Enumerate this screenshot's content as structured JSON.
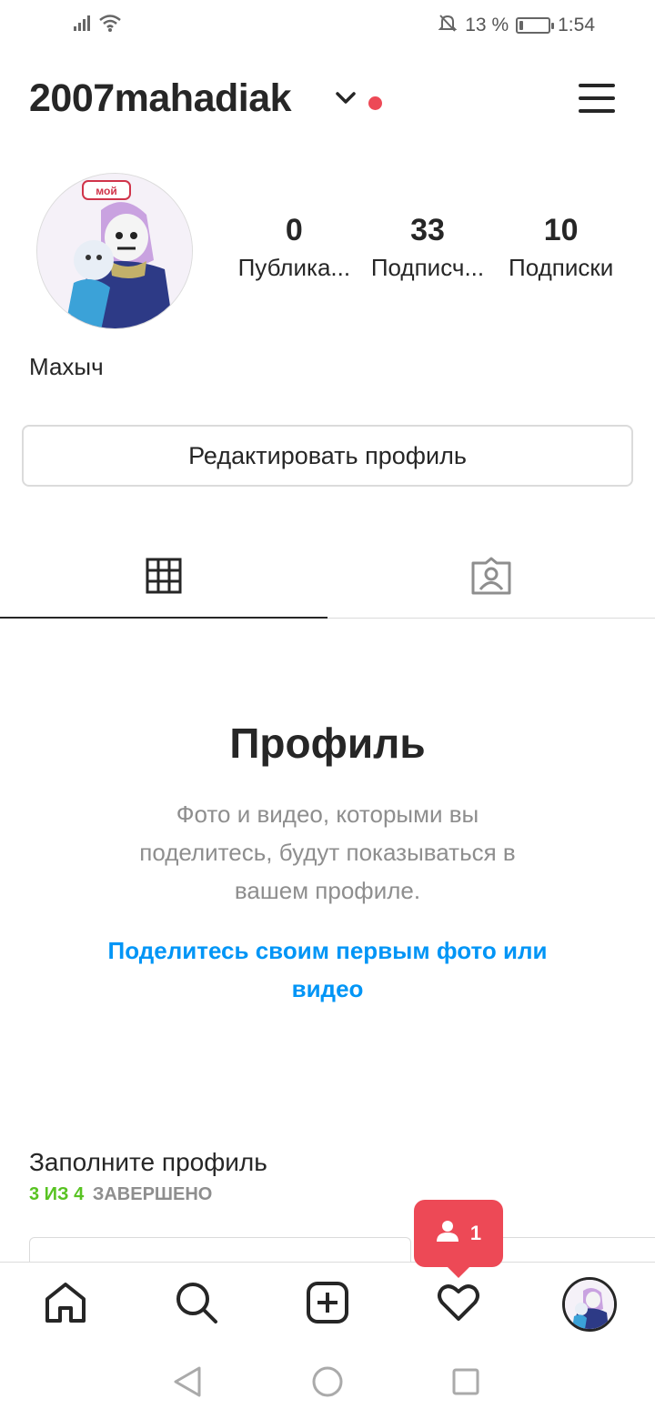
{
  "status_bar": {
    "battery_text": "13 %",
    "battery_level_percent": 13,
    "time": "1:54",
    "icons": [
      "signal-icon",
      "wifi-icon",
      "bell-muted-icon",
      "battery-charging-icon"
    ]
  },
  "header": {
    "username": "2007mahadiak",
    "has_unread_dot": true,
    "dot_color": "#ed4956"
  },
  "profile": {
    "avatar_badge": "мой",
    "full_name": "Махыч",
    "stats": [
      {
        "value": "0",
        "label": "Публика..."
      },
      {
        "value": "33",
        "label": "Подписч..."
      },
      {
        "value": "10",
        "label": "Подписки"
      }
    ],
    "edit_button_label": "Редактировать профиль"
  },
  "tabs": [
    {
      "icon": "grid-icon",
      "active": true
    },
    {
      "icon": "tagged-person-icon",
      "active": false
    }
  ],
  "empty_state": {
    "title": "Профиль",
    "description": "Фото и видео, которыми вы поделитесь, будут показываться в вашем профиле.",
    "link": "Поделитесь своим первым фото или видео"
  },
  "complete_profile": {
    "title": "Заполните профиль",
    "progress_done": "3 ИЗ 4",
    "progress_rest": "ЗАВЕРШЕНО"
  },
  "notification": {
    "count": "1",
    "icon": "person-icon"
  },
  "bottom_nav": [
    {
      "icon": "home-icon"
    },
    {
      "icon": "search-icon"
    },
    {
      "icon": "new-post-icon"
    },
    {
      "icon": "heart-icon"
    },
    {
      "icon": "profile-avatar-icon"
    }
  ],
  "colors": {
    "text": "#262626",
    "secondary": "#8e8e8e",
    "link": "#0095f6",
    "alert": "#ed4956",
    "success": "#58c322",
    "border": "#dbdbdb"
  }
}
